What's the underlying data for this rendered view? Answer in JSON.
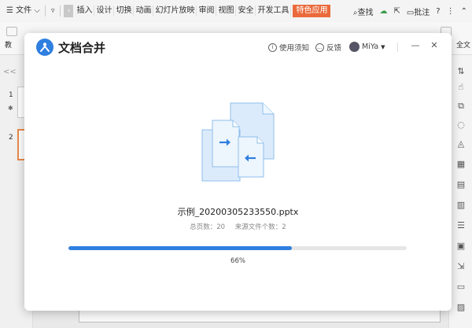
{
  "app": {
    "menu": {
      "file": "文件",
      "items": [
        "插入",
        "设计",
        "切换",
        "动画",
        "幻灯片放映",
        "审阅",
        "视图",
        "安全",
        "开发工具"
      ],
      "special": "特色应用",
      "search": "查找",
      "annotate": "批注",
      "help": "?"
    },
    "ribbon": {
      "left_label": "教",
      "right_label": "全文"
    },
    "thumbnails": {
      "collapse": "<<",
      "slides": [
        "1",
        "2"
      ]
    }
  },
  "dialog": {
    "title": "文档合并",
    "header": {
      "guide": "使用须知",
      "feedback": "反馈",
      "user": "MiYa"
    },
    "file": {
      "name": "示例_20200305233550.pptx",
      "total_pages_label": "总页数：20",
      "source_count_label": "来源文件个数：2"
    },
    "progress": {
      "percent": 66,
      "text": "66%"
    },
    "colors": {
      "accent": "#2f7fe0",
      "track": "#e6e6e6"
    },
    "icons": {
      "logo": "merge-logo-icon",
      "guide": "info-icon",
      "feedback": "chat-icon",
      "minimize": "minimize-icon",
      "close": "close-icon"
    }
  }
}
